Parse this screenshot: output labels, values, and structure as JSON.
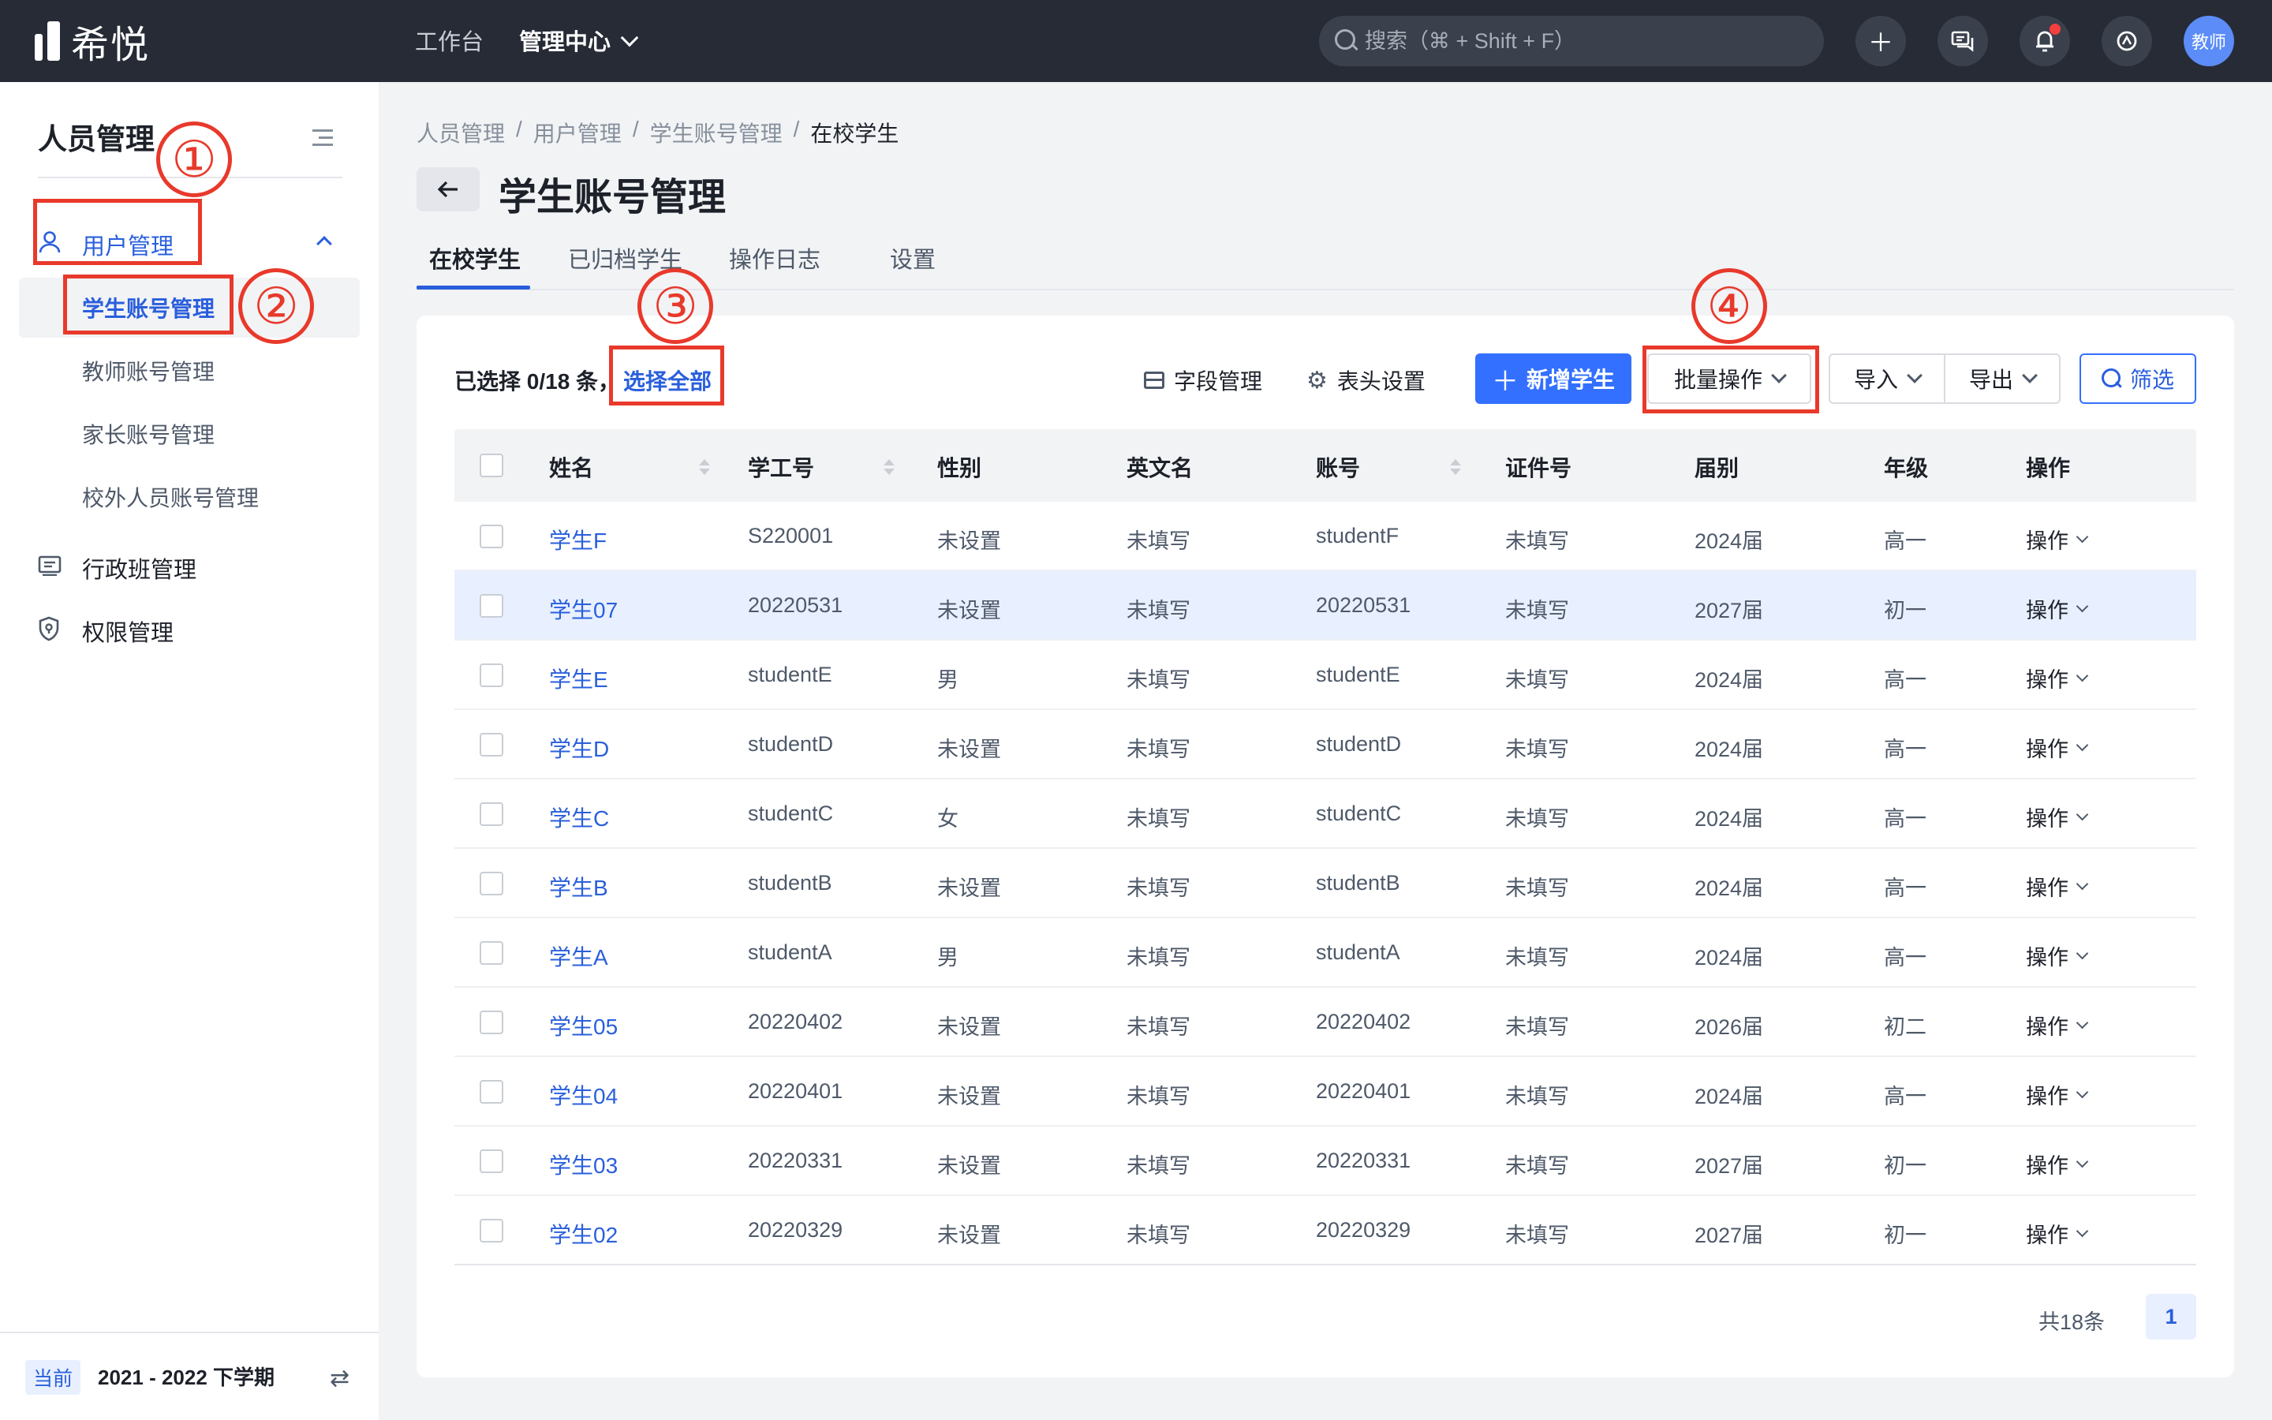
{
  "app": {
    "logo_text": "希悦",
    "nav": [
      {
        "label": "工作台"
      },
      {
        "label": "管理中心"
      }
    ],
    "search_placeholder": "搜索（⌘ + Shift + F）",
    "avatar_text": "教师",
    "icons": [
      "plus-icon",
      "message-icon",
      "bell-icon",
      "help-icon"
    ]
  },
  "sidebar": {
    "title": "人员管理",
    "groups": [
      {
        "label": "用户管理",
        "icon": "user-icon",
        "expanded": true
      },
      {
        "label": "行政班管理",
        "icon": "class-icon"
      },
      {
        "label": "权限管理",
        "icon": "shield-icon"
      }
    ],
    "sub_items": [
      {
        "label": "学生账号管理",
        "active": true
      },
      {
        "label": "教师账号管理"
      },
      {
        "label": "家长账号管理"
      },
      {
        "label": "校外人员账号管理"
      }
    ],
    "footer": {
      "badge": "当前",
      "term": "2021 - 2022 下学期"
    }
  },
  "header": {
    "breadcrumb": [
      "人员管理",
      "用户管理",
      "学生账号管理",
      "在校学生"
    ],
    "separator": "/",
    "title": "学生账号管理",
    "tabs": [
      {
        "label": "在校学生",
        "active": true
      },
      {
        "label": "已归档学生"
      },
      {
        "label": "操作日志"
      },
      {
        "label": "设置"
      }
    ]
  },
  "toolbar": {
    "selected_text": "已选择 0/18 条，",
    "select_all": "选择全部",
    "field_manage": "字段管理",
    "header_settings": "表头设置",
    "add_student": "新增学生",
    "batch": "批量操作",
    "import": "导入",
    "export": "导出",
    "filter": "筛选"
  },
  "table": {
    "columns": [
      "姓名",
      "学工号",
      "性别",
      "英文名",
      "账号",
      "证件号",
      "届别",
      "年级",
      "操作"
    ],
    "rows": [
      {
        "name": "学生F",
        "id": "S220001",
        "gender": "未设置",
        "en": "未填写",
        "account": "studentF",
        "cert": "未填写",
        "cohort": "2024届",
        "grade": "高一",
        "op": "操作"
      },
      {
        "name": "学生07",
        "id": "20220531",
        "gender": "未设置",
        "en": "未填写",
        "account": "20220531",
        "cert": "未填写",
        "cohort": "2027届",
        "grade": "初一",
        "op": "操作"
      },
      {
        "name": "学生E",
        "id": "studentE",
        "gender": "男",
        "en": "未填写",
        "account": "studentE",
        "cert": "未填写",
        "cohort": "2024届",
        "grade": "高一",
        "op": "操作"
      },
      {
        "name": "学生D",
        "id": "studentD",
        "gender": "未设置",
        "en": "未填写",
        "account": "studentD",
        "cert": "未填写",
        "cohort": "2024届",
        "grade": "高一",
        "op": "操作"
      },
      {
        "name": "学生C",
        "id": "studentC",
        "gender": "女",
        "en": "未填写",
        "account": "studentC",
        "cert": "未填写",
        "cohort": "2024届",
        "grade": "高一",
        "op": "操作"
      },
      {
        "name": "学生B",
        "id": "studentB",
        "gender": "未设置",
        "en": "未填写",
        "account": "studentB",
        "cert": "未填写",
        "cohort": "2024届",
        "grade": "高一",
        "op": "操作"
      },
      {
        "name": "学生A",
        "id": "studentA",
        "gender": "男",
        "en": "未填写",
        "account": "studentA",
        "cert": "未填写",
        "cohort": "2024届",
        "grade": "高一",
        "op": "操作"
      },
      {
        "name": "学生05",
        "id": "20220402",
        "gender": "未设置",
        "en": "未填写",
        "account": "20220402",
        "cert": "未填写",
        "cohort": "2026届",
        "grade": "初二",
        "op": "操作"
      },
      {
        "name": "学生04",
        "id": "20220401",
        "gender": "未设置",
        "en": "未填写",
        "account": "20220401",
        "cert": "未填写",
        "cohort": "2024届",
        "grade": "高一",
        "op": "操作"
      },
      {
        "name": "学生03",
        "id": "20220331",
        "gender": "未设置",
        "en": "未填写",
        "account": "20220331",
        "cert": "未填写",
        "cohort": "2027届",
        "grade": "初一",
        "op": "操作"
      },
      {
        "name": "学生02",
        "id": "20220329",
        "gender": "未设置",
        "en": "未填写",
        "account": "20220329",
        "cert": "未填写",
        "cohort": "2027届",
        "grade": "初一",
        "op": "操作"
      }
    ]
  },
  "pagination": {
    "total": "共18条",
    "current": "1"
  },
  "annotations": [
    "①",
    "②",
    "③",
    "④"
  ],
  "colors": {
    "accent": "#3370ff",
    "annotation": "#e8392b",
    "topbar": "#262b36"
  }
}
